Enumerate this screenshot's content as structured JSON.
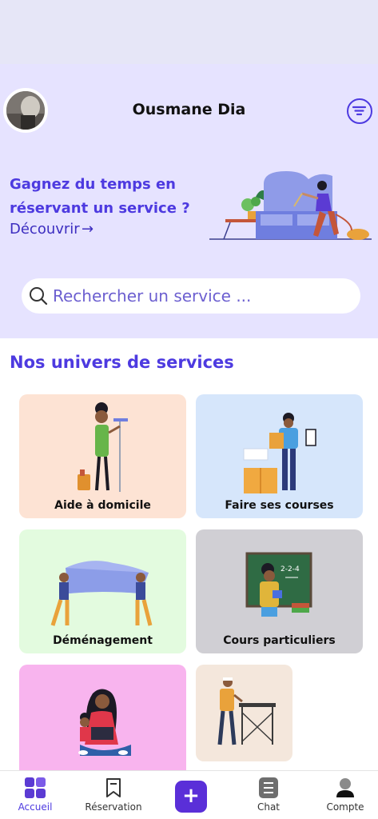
{
  "header": {
    "user_name": "Ousmane Dia"
  },
  "promo": {
    "title": "Gagnez du temps en réservant un service ?",
    "link_label": "Découvrir",
    "link_arrow": "→"
  },
  "search": {
    "placeholder": "Rechercher un service ..."
  },
  "services": {
    "title": "Nos univers de services",
    "items": [
      {
        "label": "Aide à domicile",
        "color": "#fde3d4"
      },
      {
        "label": "Faire ses courses",
        "color": "#d6e6fb"
      },
      {
        "label": "Déménagement",
        "color": "#e3fbdf"
      },
      {
        "label": "Cours particuliers",
        "color": "#d0cfd4"
      },
      {
        "label": "",
        "color": "#f8b4ee"
      },
      {
        "label": "",
        "color": "#f4e7dc"
      }
    ]
  },
  "tabbar": {
    "items": [
      {
        "label": "Accueil",
        "icon": "grid-icon",
        "active": true
      },
      {
        "label": "Réservation",
        "icon": "bookmark-icon",
        "active": false
      },
      {
        "label": "",
        "icon": "plus-icon",
        "active": false
      },
      {
        "label": "Chat",
        "icon": "chat-icon",
        "active": false
      },
      {
        "label": "Compte",
        "icon": "user-icon",
        "active": false
      }
    ]
  },
  "colors": {
    "accent": "#4d3ae0",
    "hero_background": "#e6e3ff"
  }
}
